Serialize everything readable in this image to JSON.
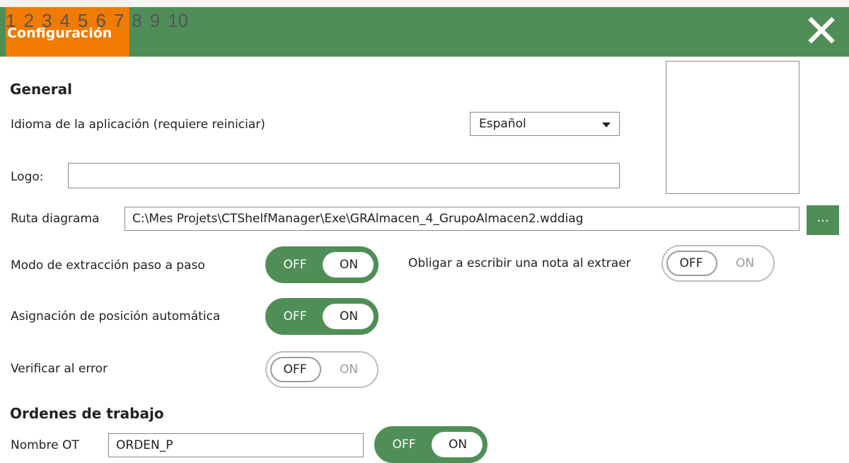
{
  "header": {
    "tab_numbers": [
      "1",
      "2",
      "3",
      "4",
      "5",
      "6",
      "7",
      "8",
      "9",
      "10"
    ],
    "active_tab_title": "Configuración",
    "close_icon": "close-icon",
    "colors": {
      "header_green": "#4f8f57",
      "active_tab_orange": "#f17a00"
    }
  },
  "general": {
    "title": "General",
    "language": {
      "label": "Idioma de la aplicación (requiere reiniciar)",
      "selected": "Español"
    },
    "logo": {
      "label": "Logo:",
      "value": ""
    },
    "diagram_path": {
      "label": "Ruta diagrama",
      "value": "C:\\Mes Projets\\CTShelfManager\\Exe\\GRAlmacen_4_GrupoAlmacen2.wddiag",
      "browse_label": "..."
    },
    "step_extraction": {
      "label": "Modo de extracción paso a paso",
      "off": "OFF",
      "on": "ON",
      "state": "ON"
    },
    "force_note": {
      "label": "Obligar a escribir una nota al extraer",
      "off": "OFF",
      "on": "ON",
      "state": "OFF"
    },
    "auto_position": {
      "label": "Asignación de posición automática",
      "off": "OFF",
      "on": "ON",
      "state": "ON"
    },
    "verify_error": {
      "label": "Verificar al error",
      "off": "OFF",
      "on": "ON",
      "state": "OFF"
    }
  },
  "work_orders": {
    "title": "Ordenes de trabajo",
    "name": {
      "label": "Nombre OT",
      "value": "ORDEN_P"
    },
    "toggle": {
      "off": "OFF",
      "on": "ON",
      "state": "ON"
    }
  }
}
